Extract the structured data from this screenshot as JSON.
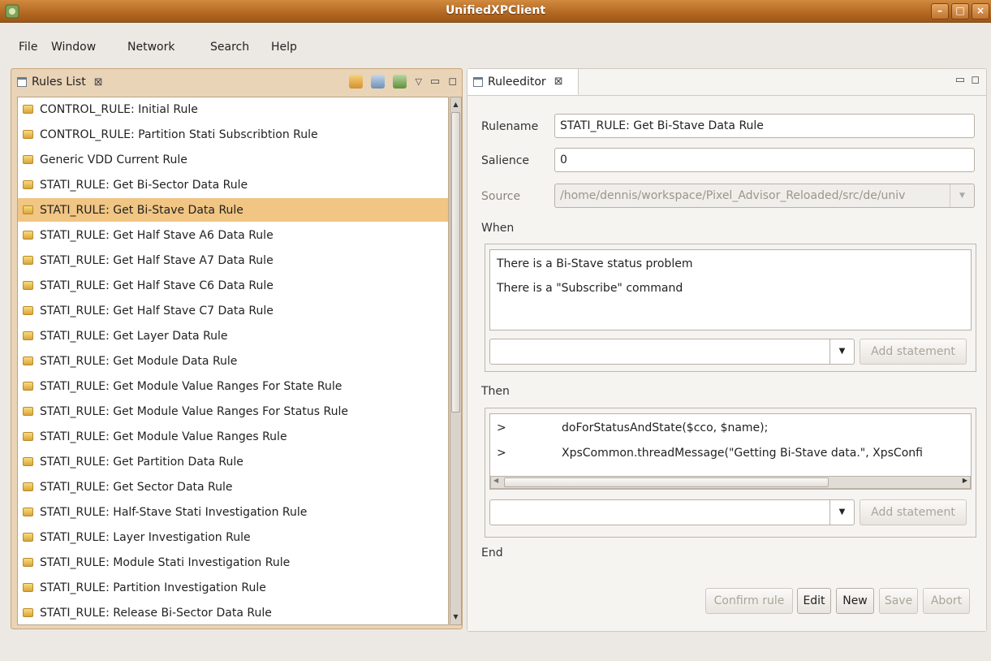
{
  "window": {
    "title": "UnifiedXPClient"
  },
  "menu": [
    "File",
    "Window",
    "Network",
    "Search",
    "Help"
  ],
  "rules_list": {
    "tab_label": "Rules List",
    "selected_index": 4,
    "items": [
      "CONTROL_RULE: Initial Rule",
      "CONTROL_RULE: Partition Stati Subscribtion Rule",
      "Generic VDD Current Rule",
      "STATI_RULE: Get Bi-Sector Data Rule",
      "STATI_RULE: Get Bi-Stave Data Rule",
      "STATI_RULE: Get Half Stave A6 Data Rule",
      "STATI_RULE: Get Half Stave A7 Data Rule",
      "STATI_RULE: Get Half Stave C6 Data Rule",
      "STATI_RULE: Get Half Stave C7 Data Rule",
      "STATI_RULE: Get Layer Data Rule",
      "STATI_RULE: Get Module Data Rule",
      "STATI_RULE: Get Module Value Ranges For State Rule",
      "STATI_RULE: Get Module Value Ranges For Status Rule",
      "STATI_RULE: Get Module Value Ranges Rule",
      "STATI_RULE: Get Partition Data Rule",
      "STATI_RULE: Get Sector Data Rule",
      "STATI_RULE: Half-Stave Stati Investigation Rule",
      "STATI_RULE: Layer Investigation Rule",
      "STATI_RULE: Module Stati Investigation Rule",
      "STATI_RULE: Partition Investigation Rule",
      "STATI_RULE: Release Bi-Sector Data Rule"
    ]
  },
  "editor": {
    "tab_label": "Ruleeditor",
    "rulename_label": "Rulename",
    "rulename_value": "STATI_RULE: Get Bi-Stave Data Rule",
    "salience_label": "Salience",
    "salience_value": "0",
    "source_label": "Source",
    "source_value": "/home/dennis/workspace/Pixel_Advisor_Reloaded/src/de/univ",
    "when_label": "When",
    "when_lines": [
      "There is a Bi-Stave status problem",
      "There is a \"Subscribe\" command"
    ],
    "add_statement_label": "Add statement",
    "then_label": "Then",
    "then_lines": [
      {
        "marker": ">",
        "code": "doForStatusAndState($cco, $name);"
      },
      {
        "marker": ">",
        "code": "XpsCommon.threadMessage(\"Getting Bi-Stave data.\", XpsConfi"
      }
    ],
    "end_label": "End",
    "buttons": {
      "confirm": "Confirm rule",
      "edit": "Edit",
      "new": "New",
      "save": "Save",
      "abort": "Abort"
    }
  }
}
